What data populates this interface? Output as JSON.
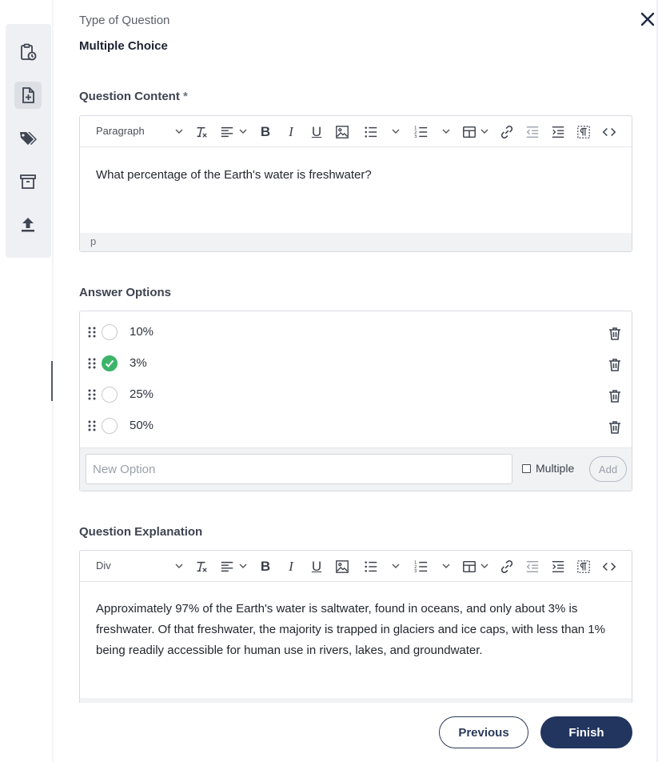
{
  "close_icon": "close-icon",
  "sidebar": {
    "items": [
      {
        "name": "clipboard-clock-icon",
        "active": false
      },
      {
        "name": "file-plus-icon",
        "active": true
      },
      {
        "name": "tags-icon",
        "active": false
      },
      {
        "name": "archive-icon",
        "active": false
      },
      {
        "name": "upload-icon",
        "active": false
      }
    ]
  },
  "question_type": {
    "label": "Type of Question",
    "value": "Multiple Choice"
  },
  "question_content": {
    "label": "Question Content",
    "required_mark": "*",
    "block_format": "Paragraph",
    "text": "What percentage of the Earth's water is freshwater?",
    "status_path": "p"
  },
  "answer_options": {
    "label": "Answer Options",
    "options": [
      {
        "text": "10%",
        "correct": false
      },
      {
        "text": "3%",
        "correct": true
      },
      {
        "text": "25%",
        "correct": false
      },
      {
        "text": "50%",
        "correct": false
      }
    ],
    "new_option_placeholder": "New Option",
    "multiple_label": "Multiple",
    "multiple_checked": false,
    "add_label": "Add"
  },
  "question_explanation": {
    "label": "Question Explanation",
    "block_format": "Div",
    "text": "Approximately 97% of the Earth's water is saltwater, found in oceans, and only about 3% is freshwater. Of that freshwater, the majority is trapped in glaciers and ice caps, with less than 1% being readily accessible for human use in rivers, lakes, and groundwater."
  },
  "footer": {
    "previous_label": "Previous",
    "finish_label": "Finish"
  },
  "colors": {
    "primary": "#22355e",
    "correct": "#3cb56a"
  }
}
